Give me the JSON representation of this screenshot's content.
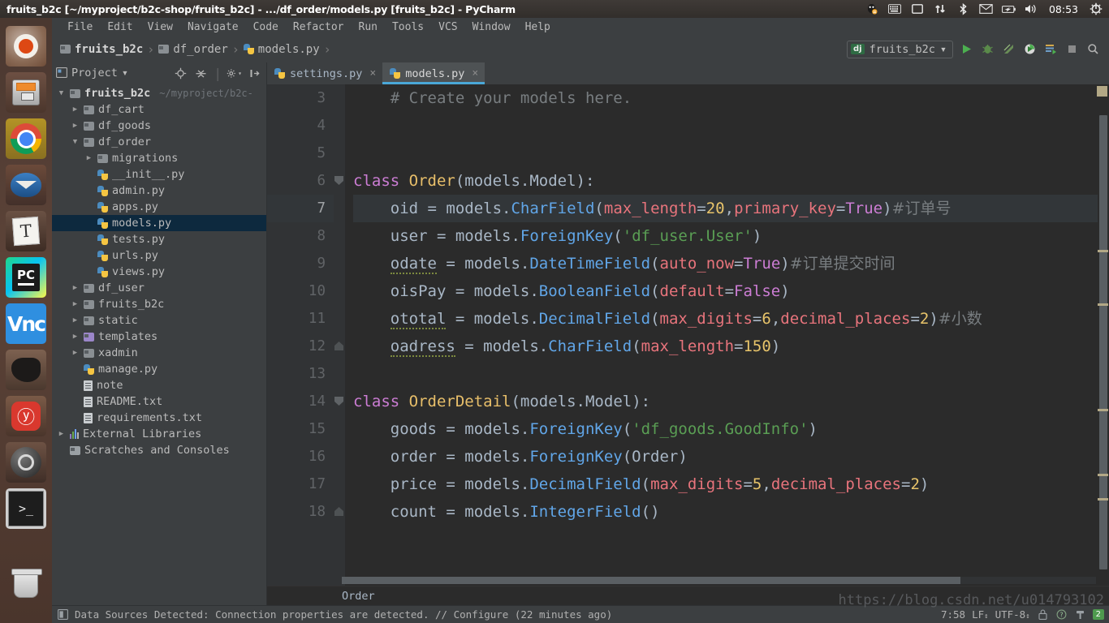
{
  "window": {
    "title": "fruits_b2c [~/myproject/b2c-shop/fruits_b2c] - .../df_order/models.py [fruits_b2c] - PyCharm"
  },
  "tray": {
    "clock": "08:53",
    "icons": [
      "qq-icon",
      "keyboard-icon",
      "display-icon",
      "network-icon",
      "bluetooth-icon",
      "mail-icon",
      "battery-icon",
      "volume-icon",
      "power-gear-icon"
    ]
  },
  "launcher": {
    "items": [
      {
        "name": "ubuntu-dash-icon",
        "label": "Ubuntu Dash",
        "active": false
      },
      {
        "name": "files-icon",
        "label": "Files",
        "active": false
      },
      {
        "name": "chrome-icon",
        "label": "Google Chrome",
        "active": true
      },
      {
        "name": "thunderbird-icon",
        "label": "Thunderbird",
        "active": false
      },
      {
        "name": "text-editor-icon",
        "label": "Text Editor",
        "active": false
      },
      {
        "name": "pycharm-icon",
        "label": "PyCharm",
        "active": true
      },
      {
        "name": "vnc-icon",
        "label": "VNC Viewer",
        "active": false
      },
      {
        "name": "dbeaver-icon",
        "label": "DBeaver",
        "active": false
      },
      {
        "name": "netease-music-icon",
        "label": "NetEase Music",
        "active": false
      },
      {
        "name": "steam-icon",
        "label": "Steam",
        "active": false
      },
      {
        "name": "terminal-icon",
        "label": "Terminal",
        "active": true
      },
      {
        "name": "trash-icon",
        "label": "Trash",
        "active": false
      }
    ],
    "vnc_glyph": "Vn\nc",
    "music_glyph": "ⓨ",
    "text_glyph": "T",
    "terminal_glyph": ">_",
    "pycharm_glyph": "PC"
  },
  "menubar": {
    "items": [
      "File",
      "Edit",
      "View",
      "Navigate",
      "Code",
      "Refactor",
      "Run",
      "Tools",
      "VCS",
      "Window",
      "Help"
    ]
  },
  "navbar": {
    "breadcrumbs": [
      {
        "label": "fruits_b2c",
        "icon": "folder-icon",
        "bold": true
      },
      {
        "label": "df_order",
        "icon": "folder-icon",
        "bold": false
      },
      {
        "label": "models.py",
        "icon": "python-file-icon",
        "bold": false
      }
    ],
    "separator": "›",
    "run_config": {
      "badge": "dj",
      "name": "fruits_b2c",
      "caret": "▾"
    },
    "buttons": [
      "run-button",
      "debug-button",
      "coverage-button",
      "profile-button",
      "run-with-console-button",
      "stop-button",
      "search-everywhere-button"
    ]
  },
  "project_panel": {
    "title": "Project",
    "title_caret": "▾",
    "tools": [
      "locate-icon",
      "collapse-all-icon",
      "settings-gear-icon",
      "hide-panel-icon"
    ],
    "tree": [
      {
        "depth": 0,
        "twisty": "▼",
        "icon": "folder-icon",
        "label": "fruits_b2c",
        "bold": true,
        "sub": "~/myproject/b2c-",
        "selected": false
      },
      {
        "depth": 1,
        "twisty": "▶",
        "icon": "folder-icon",
        "label": "df_cart",
        "bold": false,
        "sub": "",
        "selected": false
      },
      {
        "depth": 1,
        "twisty": "▶",
        "icon": "folder-icon",
        "label": "df_goods",
        "bold": false,
        "sub": "",
        "selected": false
      },
      {
        "depth": 1,
        "twisty": "▼",
        "icon": "folder-icon",
        "label": "df_order",
        "bold": false,
        "sub": "",
        "selected": false
      },
      {
        "depth": 2,
        "twisty": "▶",
        "icon": "folder-icon",
        "label": "migrations",
        "bold": false,
        "sub": "",
        "selected": false
      },
      {
        "depth": 2,
        "twisty": "",
        "icon": "python-file-icon",
        "label": "__init__.py",
        "bold": false,
        "sub": "",
        "selected": false
      },
      {
        "depth": 2,
        "twisty": "",
        "icon": "python-file-icon",
        "label": "admin.py",
        "bold": false,
        "sub": "",
        "selected": false
      },
      {
        "depth": 2,
        "twisty": "",
        "icon": "python-file-icon",
        "label": "apps.py",
        "bold": false,
        "sub": "",
        "selected": false
      },
      {
        "depth": 2,
        "twisty": "",
        "icon": "python-file-icon",
        "label": "models.py",
        "bold": false,
        "sub": "",
        "selected": true
      },
      {
        "depth": 2,
        "twisty": "",
        "icon": "python-file-icon",
        "label": "tests.py",
        "bold": false,
        "sub": "",
        "selected": false
      },
      {
        "depth": 2,
        "twisty": "",
        "icon": "python-file-icon",
        "label": "urls.py",
        "bold": false,
        "sub": "",
        "selected": false
      },
      {
        "depth": 2,
        "twisty": "",
        "icon": "python-file-icon",
        "label": "views.py",
        "bold": false,
        "sub": "",
        "selected": false
      },
      {
        "depth": 1,
        "twisty": "▶",
        "icon": "folder-icon",
        "label": "df_user",
        "bold": false,
        "sub": "",
        "selected": false
      },
      {
        "depth": 1,
        "twisty": "▶",
        "icon": "folder-icon",
        "label": "fruits_b2c",
        "bold": false,
        "sub": "",
        "selected": false
      },
      {
        "depth": 1,
        "twisty": "▶",
        "icon": "folder-icon",
        "label": "static",
        "bold": false,
        "sub": "",
        "selected": false
      },
      {
        "depth": 1,
        "twisty": "▶",
        "icon": "folder-purple-icon",
        "label": "templates",
        "bold": false,
        "sub": "",
        "selected": false
      },
      {
        "depth": 1,
        "twisty": "▶",
        "icon": "folder-icon",
        "label": "xadmin",
        "bold": false,
        "sub": "",
        "selected": false
      },
      {
        "depth": 1,
        "twisty": "",
        "icon": "python-file-icon",
        "label": "manage.py",
        "bold": false,
        "sub": "",
        "selected": false
      },
      {
        "depth": 1,
        "twisty": "",
        "icon": "text-file-icon",
        "label": "note",
        "bold": false,
        "sub": "",
        "selected": false
      },
      {
        "depth": 1,
        "twisty": "",
        "icon": "text-file-icon",
        "label": "README.txt",
        "bold": false,
        "sub": "",
        "selected": false
      },
      {
        "depth": 1,
        "twisty": "",
        "icon": "text-file-icon",
        "label": "requirements.txt",
        "bold": false,
        "sub": "",
        "selected": false
      },
      {
        "depth": 0,
        "twisty": "▶",
        "icon": "libraries-icon",
        "label": "External Libraries",
        "bold": false,
        "sub": "",
        "selected": false
      },
      {
        "depth": 0,
        "twisty": "",
        "icon": "scratches-icon",
        "label": "Scratches and Consoles",
        "bold": false,
        "sub": "",
        "selected": false
      }
    ]
  },
  "editor": {
    "tabs": [
      {
        "label": "settings.py",
        "icon": "python-file-icon",
        "active": false,
        "close": "×"
      },
      {
        "label": "models.py",
        "icon": "python-file-icon",
        "active": true,
        "close": "×"
      }
    ],
    "breadcrumb": "Order",
    "current_line": 7,
    "first_line": 3,
    "lines": [
      {
        "n": 3,
        "fold": "",
        "tokens": [
          {
            "t": "    # Create your models here.",
            "c": "cmt"
          }
        ]
      },
      {
        "n": 4,
        "fold": "",
        "tokens": []
      },
      {
        "n": 5,
        "fold": "",
        "tokens": []
      },
      {
        "n": 6,
        "fold": "open",
        "tokens": [
          {
            "t": "class ",
            "c": "kw"
          },
          {
            "t": "Order",
            "c": "cls"
          },
          {
            "t": "(models.Model):",
            "c": "plain"
          }
        ]
      },
      {
        "n": 7,
        "fold": "",
        "tokens": [
          {
            "t": "    oid = models.",
            "c": "plain"
          },
          {
            "t": "CharField",
            "c": "fn"
          },
          {
            "t": "(",
            "c": "plain"
          },
          {
            "t": "max_length",
            "c": "param"
          },
          {
            "t": "=",
            "c": "plain"
          },
          {
            "t": "20",
            "c": "num"
          },
          {
            "t": ",",
            "c": "plain"
          },
          {
            "t": "primary_key",
            "c": "param"
          },
          {
            "t": "=",
            "c": "plain"
          },
          {
            "t": "True",
            "c": "kw"
          },
          {
            "t": ")",
            "c": "plain"
          },
          {
            "t": "#订单号",
            "c": "cmt-cjk"
          }
        ]
      },
      {
        "n": 8,
        "fold": "",
        "tokens": [
          {
            "t": "    user = models.",
            "c": "plain"
          },
          {
            "t": "ForeignKey",
            "c": "fn"
          },
          {
            "t": "(",
            "c": "plain"
          },
          {
            "t": "'df_user.User'",
            "c": "str"
          },
          {
            "t": ")",
            "c": "plain"
          }
        ]
      },
      {
        "n": 9,
        "fold": "",
        "tokens": [
          {
            "t": "    ",
            "c": "plain"
          },
          {
            "t": "odate",
            "c": "sq"
          },
          {
            "t": " = models.",
            "c": "plain"
          },
          {
            "t": "DateTimeField",
            "c": "fn"
          },
          {
            "t": "(",
            "c": "plain"
          },
          {
            "t": "auto_now",
            "c": "param"
          },
          {
            "t": "=",
            "c": "plain"
          },
          {
            "t": "True",
            "c": "kw"
          },
          {
            "t": ")",
            "c": "plain"
          },
          {
            "t": "#订单提交时间",
            "c": "cmt-cjk"
          }
        ]
      },
      {
        "n": 10,
        "fold": "",
        "tokens": [
          {
            "t": "    oisPay = models.",
            "c": "plain"
          },
          {
            "t": "BooleanField",
            "c": "fn"
          },
          {
            "t": "(",
            "c": "plain"
          },
          {
            "t": "default",
            "c": "param"
          },
          {
            "t": "=",
            "c": "plain"
          },
          {
            "t": "False",
            "c": "kw"
          },
          {
            "t": ")",
            "c": "plain"
          }
        ]
      },
      {
        "n": 11,
        "fold": "",
        "tokens": [
          {
            "t": "    ",
            "c": "plain"
          },
          {
            "t": "ototal",
            "c": "sq"
          },
          {
            "t": " = models.",
            "c": "plain"
          },
          {
            "t": "DecimalField",
            "c": "fn"
          },
          {
            "t": "(",
            "c": "plain"
          },
          {
            "t": "max_digits",
            "c": "param"
          },
          {
            "t": "=",
            "c": "plain"
          },
          {
            "t": "6",
            "c": "num"
          },
          {
            "t": ",",
            "c": "plain"
          },
          {
            "t": "decimal_places",
            "c": "param"
          },
          {
            "t": "=",
            "c": "plain"
          },
          {
            "t": "2",
            "c": "num"
          },
          {
            "t": ")",
            "c": "plain"
          },
          {
            "t": "#小数",
            "c": "cmt-cjk"
          }
        ]
      },
      {
        "n": 12,
        "fold": "end",
        "tokens": [
          {
            "t": "    ",
            "c": "plain"
          },
          {
            "t": "oadress",
            "c": "sq"
          },
          {
            "t": " = models.",
            "c": "plain"
          },
          {
            "t": "CharField",
            "c": "fn"
          },
          {
            "t": "(",
            "c": "plain"
          },
          {
            "t": "max_length",
            "c": "param"
          },
          {
            "t": "=",
            "c": "plain"
          },
          {
            "t": "150",
            "c": "num"
          },
          {
            "t": ")",
            "c": "plain"
          }
        ]
      },
      {
        "n": 13,
        "fold": "",
        "tokens": []
      },
      {
        "n": 14,
        "fold": "open",
        "tokens": [
          {
            "t": "class ",
            "c": "kw"
          },
          {
            "t": "OrderDetail",
            "c": "cls"
          },
          {
            "t": "(models.Model):",
            "c": "plain"
          }
        ]
      },
      {
        "n": 15,
        "fold": "",
        "tokens": [
          {
            "t": "    goods = models.",
            "c": "plain"
          },
          {
            "t": "ForeignKey",
            "c": "fn"
          },
          {
            "t": "(",
            "c": "plain"
          },
          {
            "t": "'df_goods.GoodInfo'",
            "c": "str"
          },
          {
            "t": ")",
            "c": "plain"
          }
        ]
      },
      {
        "n": 16,
        "fold": "",
        "tokens": [
          {
            "t": "    order = models.",
            "c": "plain"
          },
          {
            "t": "ForeignKey",
            "c": "fn"
          },
          {
            "t": "(Order)",
            "c": "plain"
          }
        ]
      },
      {
        "n": 17,
        "fold": "",
        "tokens": [
          {
            "t": "    price = models.",
            "c": "plain"
          },
          {
            "t": "DecimalField",
            "c": "fn"
          },
          {
            "t": "(",
            "c": "plain"
          },
          {
            "t": "max_digits",
            "c": "param"
          },
          {
            "t": "=",
            "c": "plain"
          },
          {
            "t": "5",
            "c": "num"
          },
          {
            "t": ",",
            "c": "plain"
          },
          {
            "t": "decimal_places",
            "c": "param"
          },
          {
            "t": "=",
            "c": "plain"
          },
          {
            "t": "2",
            "c": "num"
          },
          {
            "t": ")",
            "c": "plain"
          }
        ]
      },
      {
        "n": 18,
        "fold": "end",
        "tokens": [
          {
            "t": "    count = models.",
            "c": "plain"
          },
          {
            "t": "IntegerField",
            "c": "fn"
          },
          {
            "t": "()",
            "c": "plain"
          }
        ]
      }
    ]
  },
  "statusbar": {
    "message": "Data Sources Detected: Connection properties are detected. // Configure (22 minutes ago)",
    "caret_position": "7:58",
    "line_separator": "LF",
    "encoding": "UTF-8",
    "event_count": "2",
    "icons": [
      "db-icon",
      "lock-icon",
      "help-icon",
      "hammer-icon"
    ]
  },
  "watermark": "https://blog.csdn.net/u014793102",
  "colors": {
    "ide_bg": "#3c3f41",
    "editor_bg": "#2b2b2b",
    "accent": "#4aa8d8",
    "selection": "#0d293e",
    "keyword": "#cc7dd4",
    "class_name": "#e8bf6a",
    "function": "#61a6e8",
    "param": "#e8747c",
    "number": "#e8c46a",
    "string": "#5a9e54",
    "comment": "#787d80"
  }
}
